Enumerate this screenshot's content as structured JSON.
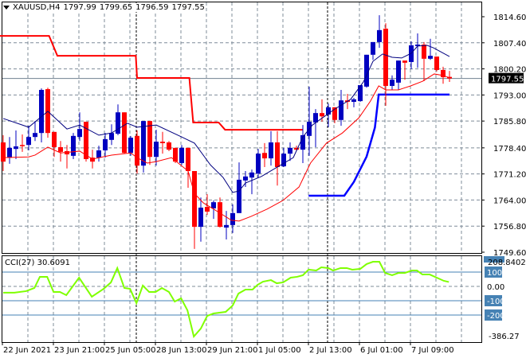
{
  "header": {
    "symbol": "XAUUSD,H4",
    "open": "1797.99",
    "high": "1799.65",
    "low": "1796.59",
    "close": "1797.55"
  },
  "colors": {
    "bull": "#0000c0",
    "bear": "#ff0000",
    "ma_fast": "#000080",
    "ma_slow": "#ff0000",
    "step_red": "#ff0000",
    "step_blue": "#0000ff",
    "cci": "#7fff00",
    "level": "#4682b4"
  },
  "price_axis": {
    "ticks": [
      "1814.60",
      "1807.40",
      "1800.20",
      "1793.00",
      "1785.80",
      "1778.40",
      "1771.20",
      "1764.00",
      "1756.80",
      "1749.60"
    ],
    "current": "1797.55",
    "range": [
      1749.6,
      1814.6
    ]
  },
  "time_axis": {
    "labels": [
      "22 Jun 2021",
      "23 Jun 21:00",
      "25 Jun 05:00",
      "28 Jun 13:00",
      "29 Jun 21:00",
      "1 Jul 05:00",
      "2 Jul 13:00",
      "6 Jul 01:00",
      "7 Jul 09:00"
    ]
  },
  "cci": {
    "title": "CCI(27) 30.6091",
    "max_label": "208.8402",
    "min_label": "-386.27",
    "levels": [
      "100",
      "0.00",
      "-100",
      "-200"
    ],
    "level_values": [
      100,
      0,
      -100,
      -200
    ],
    "range": [
      -386.27,
      208.8402
    ],
    "points": [
      [
        0,
        -44
      ],
      [
        1.75,
        -44
      ],
      [
        3.6,
        -33
      ],
      [
        4.9,
        -11
      ],
      [
        5.75,
        67
      ],
      [
        6.9,
        67
      ],
      [
        7.9,
        -39
      ],
      [
        8.9,
        -39
      ],
      [
        9.9,
        -61
      ],
      [
        11.9,
        61
      ],
      [
        13.9,
        -72
      ],
      [
        15.75,
        -17
      ],
      [
        16.9,
        28
      ],
      [
        17.9,
        128
      ],
      [
        19,
        -11
      ],
      [
        19.9,
        -17
      ],
      [
        20.9,
        -117
      ],
      [
        21.9,
        6
      ],
      [
        22.9,
        -39
      ],
      [
        23.9,
        -39
      ],
      [
        24.9,
        -11
      ],
      [
        26,
        -39
      ],
      [
        26.9,
        -106
      ],
      [
        27.9,
        -83
      ],
      [
        28.9,
        -167
      ],
      [
        29.9,
        -350
      ],
      [
        31,
        -294
      ],
      [
        32,
        -206
      ],
      [
        33,
        -189
      ],
      [
        34.9,
        -178
      ],
      [
        36,
        -133
      ],
      [
        36.9,
        -50
      ],
      [
        38,
        -22
      ],
      [
        39.1,
        -22
      ],
      [
        39.9,
        11
      ],
      [
        40.75,
        33
      ],
      [
        42,
        44
      ],
      [
        42.9,
        22
      ],
      [
        43.9,
        28
      ],
      [
        45.1,
        61
      ],
      [
        46.1,
        67
      ],
      [
        47,
        78
      ],
      [
        47.9,
        117
      ],
      [
        49.1,
        111
      ],
      [
        49.9,
        133
      ],
      [
        51,
        128
      ],
      [
        51.75,
        111
      ],
      [
        52.9,
        128
      ],
      [
        53.9,
        128
      ],
      [
        54.75,
        117
      ],
      [
        56,
        122
      ],
      [
        57,
        156
      ],
      [
        58,
        172
      ],
      [
        59,
        172
      ],
      [
        59.9,
        94
      ],
      [
        61,
        78
      ],
      [
        62,
        94
      ],
      [
        63,
        94
      ],
      [
        64.1,
        111
      ],
      [
        64.9,
        111
      ],
      [
        65.75,
        83
      ],
      [
        66.9,
        83
      ],
      [
        68,
        61
      ],
      [
        69.1,
        39
      ],
      [
        69.9,
        31
      ]
    ]
  },
  "chart_data": {
    "type": "candlestick",
    "ohlc": [
      [
        1779.9,
        1781.9,
        1772.0,
        1774.6
      ],
      [
        1775.7,
        1781.4,
        1774.0,
        1778.4
      ],
      [
        1778.1,
        1783.2,
        1775.3,
        1778.8
      ],
      [
        1779.2,
        1782.1,
        1777.3,
        1779.0
      ],
      [
        1779.2,
        1784.5,
        1777.7,
        1781.4
      ],
      [
        1781.4,
        1785.8,
        1780.3,
        1782.5
      ],
      [
        1782.5,
        1794.8,
        1779.9,
        1794.4
      ],
      [
        1794.6,
        1795.0,
        1781.2,
        1782.5
      ],
      [
        1782.8,
        1782.8,
        1775.9,
        1778.6
      ],
      [
        1778.6,
        1780.3,
        1774.6,
        1777.3
      ],
      [
        1777.5,
        1779.2,
        1772.7,
        1776.6
      ],
      [
        1776.2,
        1782.5,
        1775.3,
        1781.7
      ],
      [
        1781.4,
        1788.2,
        1780.3,
        1783.6
      ],
      [
        1785.6,
        1785.6,
        1774.6,
        1775.3
      ],
      [
        1775.7,
        1777.9,
        1772.7,
        1774.6
      ],
      [
        1775.7,
        1779.0,
        1774.6,
        1777.7
      ],
      [
        1777.7,
        1782.5,
        1775.7,
        1780.8
      ],
      [
        1780.6,
        1784.9,
        1779.2,
        1782.5
      ],
      [
        1782.3,
        1790.4,
        1781.9,
        1788.2
      ],
      [
        1788.2,
        1788.2,
        1776.8,
        1777.0
      ],
      [
        1777.0,
        1781.7,
        1776.2,
        1781.2
      ],
      [
        1781.7,
        1783.2,
        1771.3,
        1773.5
      ],
      [
        1773.5,
        1785.8,
        1771.6,
        1785.8
      ],
      [
        1785.8,
        1785.8,
        1773.7,
        1775.9
      ],
      [
        1775.9,
        1783.4,
        1773.5,
        1780.1
      ],
      [
        1780.1,
        1782.8,
        1776.8,
        1779.7
      ],
      [
        1779.9,
        1780.3,
        1777.5,
        1777.9
      ],
      [
        1778.4,
        1778.4,
        1774.2,
        1774.6
      ],
      [
        1774.2,
        1779.2,
        1773.7,
        1778.4
      ],
      [
        1778.4,
        1778.4,
        1767.4,
        1772.0
      ],
      [
        1772.0,
        1772.0,
        1750.5,
        1756.6
      ],
      [
        1756.6,
        1764.7,
        1752.5,
        1761.9
      ],
      [
        1762.1,
        1765.6,
        1759.9,
        1760.8
      ],
      [
        1761.7,
        1763.9,
        1758.8,
        1763.4
      ],
      [
        1763.4,
        1764.7,
        1756.4,
        1756.6
      ],
      [
        1756.4,
        1761.0,
        1753.1,
        1757.1
      ],
      [
        1757.1,
        1762.8,
        1754.9,
        1760.4
      ],
      [
        1760.4,
        1774.4,
        1760.4,
        1769.6
      ],
      [
        1769.4,
        1772.0,
        1767.6,
        1770.5
      ],
      [
        1770.2,
        1772.4,
        1765.6,
        1771.6
      ],
      [
        1771.3,
        1778.1,
        1770.2,
        1776.8
      ],
      [
        1777.0,
        1779.7,
        1773.1,
        1775.5
      ],
      [
        1775.5,
        1783.0,
        1773.5,
        1779.9
      ],
      [
        1779.9,
        1783.0,
        1768.0,
        1773.1
      ],
      [
        1773.3,
        1778.4,
        1773.1,
        1776.8
      ],
      [
        1776.8,
        1779.9,
        1774.8,
        1778.4
      ],
      [
        1778.4,
        1779.0,
        1777.5,
        1777.9
      ],
      [
        1777.9,
        1784.7,
        1774.2,
        1781.9
      ],
      [
        1781.7,
        1795.3,
        1776.2,
        1785.6
      ],
      [
        1785.4,
        1789.1,
        1778.6,
        1788.0
      ],
      [
        1788.0,
        1791.8,
        1785.6,
        1787.1
      ],
      [
        1787.6,
        1790.6,
        1784.1,
        1789.6
      ],
      [
        1789.6,
        1789.6,
        1785.2,
        1786.1
      ],
      [
        1786.1,
        1794.4,
        1784.5,
        1791.5
      ],
      [
        1791.5,
        1793.3,
        1789.1,
        1791.1
      ],
      [
        1791.1,
        1792.2,
        1789.6,
        1791.8
      ],
      [
        1791.3,
        1795.7,
        1791.1,
        1795.7
      ],
      [
        1795.3,
        1804.1,
        1795.0,
        1804.1
      ],
      [
        1804.1,
        1807.6,
        1802.7,
        1807.6
      ],
      [
        1807.6,
        1815.0,
        1806.0,
        1810.9
      ],
      [
        1811.3,
        1812.8,
        1790.0,
        1795.5
      ],
      [
        1795.5,
        1798.4,
        1794.4,
        1797.2
      ],
      [
        1796.4,
        1802.5,
        1794.4,
        1802.5
      ],
      [
        1802.5,
        1802.5,
        1797.2,
        1801.9
      ],
      [
        1802.1,
        1807.8,
        1800.1,
        1806.7
      ],
      [
        1806.5,
        1810.0,
        1800.5,
        1806.9
      ],
      [
        1806.9,
        1807.6,
        1796.8,
        1803.0
      ],
      [
        1803.0,
        1808.5,
        1802.7,
        1803.8
      ],
      [
        1803.6,
        1803.6,
        1799.5,
        1799.9
      ],
      [
        1799.9,
        1800.8,
        1796.1,
        1797.9
      ],
      [
        1797.99,
        1799.65,
        1796.59,
        1797.55
      ]
    ],
    "ma_fast": [
      [
        0,
        1786.5
      ],
      [
        4,
        1784.1
      ],
      [
        7,
        1788.5
      ],
      [
        10,
        1783.6
      ],
      [
        12,
        1784.7
      ],
      [
        15,
        1781.9
      ],
      [
        17,
        1782.5
      ],
      [
        19.5,
        1785.2
      ],
      [
        21,
        1784.1
      ],
      [
        24,
        1784.7
      ],
      [
        28,
        1781.4
      ],
      [
        30,
        1779.7
      ],
      [
        32.5,
        1773.7
      ],
      [
        34.5,
        1770.2
      ],
      [
        36,
        1766.1
      ],
      [
        37,
        1766.5
      ],
      [
        38,
        1768.7
      ],
      [
        40.5,
        1770.5
      ],
      [
        43,
        1773.1
      ],
      [
        45.5,
        1775.7
      ],
      [
        47,
        1781.4
      ],
      [
        48.5,
        1784.7
      ],
      [
        52,
        1789.1
      ],
      [
        54.5,
        1791.8
      ],
      [
        56.5,
        1796.6
      ],
      [
        58,
        1802.3
      ],
      [
        59.5,
        1804.3
      ],
      [
        61,
        1803.4
      ],
      [
        62.5,
        1803.2
      ],
      [
        64,
        1804.5
      ],
      [
        65,
        1806.5
      ],
      [
        66.5,
        1806.7
      ],
      [
        67.5,
        1806.0
      ],
      [
        70,
        1803.6
      ]
    ],
    "ma_slow": [
      [
        0,
        1775.7
      ],
      [
        4,
        1775.9
      ],
      [
        5,
        1776.4
      ],
      [
        7,
        1778.6
      ],
      [
        9,
        1777.0
      ],
      [
        12,
        1777.5
      ],
      [
        14,
        1775.3
      ],
      [
        17,
        1776.4
      ],
      [
        20,
        1777.0
      ],
      [
        21,
        1775.7
      ],
      [
        22.6,
        1774.2
      ],
      [
        24,
        1774.6
      ],
      [
        26.4,
        1775.7
      ],
      [
        29,
        1772.0
      ],
      [
        30,
        1765.8
      ],
      [
        31.4,
        1763.2
      ],
      [
        33,
        1761.5
      ],
      [
        35.8,
        1758.4
      ],
      [
        37,
        1758.2
      ],
      [
        38.9,
        1759.5
      ],
      [
        41.4,
        1761.5
      ],
      [
        43.9,
        1763.9
      ],
      [
        46.4,
        1767.6
      ],
      [
        48.2,
        1774.2
      ],
      [
        50.7,
        1779.7
      ],
      [
        53.2,
        1782.5
      ],
      [
        55.8,
        1786.7
      ],
      [
        57.6,
        1791.3
      ],
      [
        58.9,
        1795.5
      ],
      [
        60,
        1794.4
      ],
      [
        62,
        1794.4
      ],
      [
        63.9,
        1795.5
      ],
      [
        65.8,
        1796.8
      ],
      [
        67.6,
        1798.8
      ],
      [
        68.9,
        1798.4
      ],
      [
        69.8,
        1797.9
      ]
    ],
    "step_red": [
      [
        -0.5,
        1809.3
      ],
      [
        7.2,
        1809.3
      ],
      [
        8.5,
        1803.8
      ],
      [
        20.8,
        1803.8
      ],
      [
        21.0,
        1797.7
      ],
      [
        29.2,
        1797.7
      ],
      [
        29.8,
        1785.4
      ],
      [
        33.8,
        1785.4
      ],
      [
        34.8,
        1783.4
      ],
      [
        47.0,
        1783.4
      ]
    ],
    "step_blue": [
      [
        47.9,
        1765.2
      ],
      [
        53.5,
        1765.2
      ],
      [
        55,
        1769
      ],
      [
        57,
        1776
      ],
      [
        58.3,
        1784
      ],
      [
        58.9,
        1793.1
      ],
      [
        70,
        1793.1
      ]
    ]
  }
}
